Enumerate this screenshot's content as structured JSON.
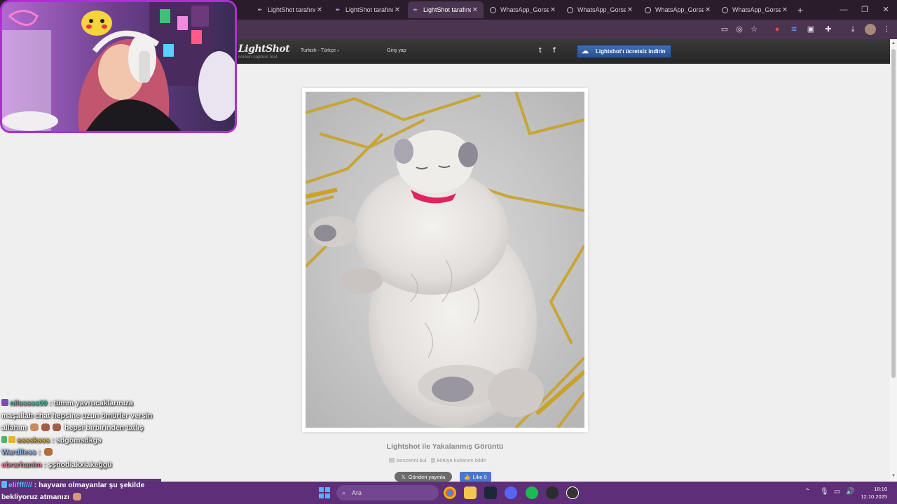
{
  "browser": {
    "tabs": [
      {
        "title": "LightShot tarafından",
        "icon": "feather-icon"
      },
      {
        "title": "LightShot tarafından",
        "icon": "feather-icon"
      },
      {
        "title": "LightShot tarafından",
        "icon": "feather-icon",
        "active": true
      },
      {
        "title": "WhatsApp_Gorsel",
        "icon": "globe-icon"
      },
      {
        "title": "WhatsApp_Gorsel",
        "icon": "globe-icon"
      },
      {
        "title": "WhatsApp_Gorsel",
        "icon": "globe-icon"
      },
      {
        "title": "WhatsApp_Gorsel",
        "icon": "globe-icon"
      }
    ],
    "new_tab": "+",
    "close_glyph": "✕"
  },
  "lightshot": {
    "logo": "LightShot",
    "logo_sub": "screen capture tool",
    "language": "Turkish - Türkçe",
    "login": "Giriş yap",
    "twitter": "t",
    "facebook": "f",
    "download_button": "Lightshot'ı ücretsiz indirin",
    "caption_title": "Lightshot ile Yakalanmış Görüntü",
    "find_similar": "benzerini bul",
    "report_abuse": "kötüye kullanım bildir",
    "tweet_button": "Gönderi yayınla",
    "like_button": "Like 0"
  },
  "chat": {
    "messages": [
      {
        "user": "nilsssss09",
        "user_color": "#3ec9a7",
        "text": ": tümm yavrucaklarınıza maşallah chat hepsine uzun ömürler versin allahım",
        "tail": "hepsi birbirinden tatlış"
      },
      {
        "user": "ssssksss",
        "user_color": "#e2b23b",
        "text": ": sdgömsdkgs"
      },
      {
        "user": "Wardlless",
        "user_color": "#9ab7e6",
        "text": ":"
      },
      {
        "user": "ebrarhanim",
        "user_color": "#e07a8c",
        "text": ": şşhodiakxiakeğgü"
      }
    ],
    "last_message": {
      "user": "elifff////",
      "user_color": "#58b8ff",
      "text": ": hayvanı olmayanlar şu şekilde bekliyoruz atmanızı"
    }
  },
  "taskbar": {
    "search_placeholder": "Ara",
    "time": "18:16",
    "date": "12.10.2025"
  },
  "colors": {
    "tab_strip": "#2a1c2b",
    "toolbar": "#4a3450",
    "taskbar": "#5e2e78",
    "webcam_border": "#b12fd0",
    "download_button": "#2f5da2"
  }
}
